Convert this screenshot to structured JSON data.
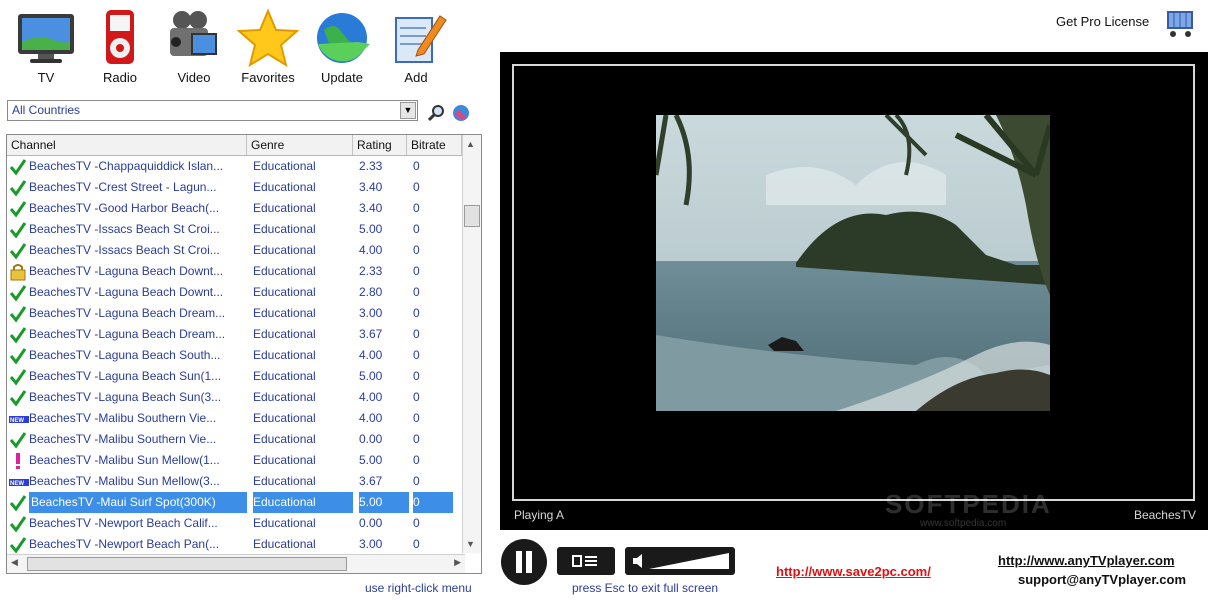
{
  "toolbar": {
    "items": [
      {
        "label": "TV",
        "icon": "tv-icon"
      },
      {
        "label": "Radio",
        "icon": "radio-icon"
      },
      {
        "label": "Video",
        "icon": "video-camera-icon"
      },
      {
        "label": "Favorites",
        "icon": "star-icon"
      },
      {
        "label": "Update",
        "icon": "globe-update-icon"
      },
      {
        "label": "Add",
        "icon": "add-notepad-icon"
      }
    ]
  },
  "pro_license": {
    "label": "Get Pro License",
    "icon": "shopping-cart-icon"
  },
  "country_filter": {
    "value": "All Countries",
    "icons": [
      "search-icon",
      "globe-filter-icon"
    ]
  },
  "channel_list": {
    "columns": [
      "Channel",
      "Genre",
      "Rating",
      "Bitrate"
    ],
    "rows": [
      {
        "status": "check",
        "channel": "BeachesTV -Chappaquiddick Islan...",
        "genre": "Educational",
        "rating": "2.33",
        "bitrate": "0"
      },
      {
        "status": "check",
        "channel": "BeachesTV -Crest Street - Lagun...",
        "genre": "Educational",
        "rating": "3.40",
        "bitrate": "0"
      },
      {
        "status": "check",
        "channel": "BeachesTV -Good Harbor Beach(...",
        "genre": "Educational",
        "rating": "3.40",
        "bitrate": "0"
      },
      {
        "status": "check",
        "channel": "BeachesTV -Issacs Beach St Croi...",
        "genre": "Educational",
        "rating": "5.00",
        "bitrate": "0"
      },
      {
        "status": "check",
        "channel": "BeachesTV -Issacs Beach St Croi...",
        "genre": "Educational",
        "rating": "4.00",
        "bitrate": "0"
      },
      {
        "status": "lock",
        "channel": "BeachesTV -Laguna Beach Downt...",
        "genre": "Educational",
        "rating": "2.33",
        "bitrate": "0"
      },
      {
        "status": "check",
        "channel": "BeachesTV -Laguna Beach Downt...",
        "genre": "Educational",
        "rating": "2.80",
        "bitrate": "0"
      },
      {
        "status": "check",
        "channel": "BeachesTV -Laguna Beach Dream...",
        "genre": "Educational",
        "rating": "3.00",
        "bitrate": "0"
      },
      {
        "status": "check",
        "channel": "BeachesTV -Laguna Beach Dream...",
        "genre": "Educational",
        "rating": "3.67",
        "bitrate": "0"
      },
      {
        "status": "check",
        "channel": "BeachesTV -Laguna Beach South...",
        "genre": "Educational",
        "rating": "4.00",
        "bitrate": "0"
      },
      {
        "status": "check",
        "channel": "BeachesTV -Laguna Beach Sun(1...",
        "genre": "Educational",
        "rating": "5.00",
        "bitrate": "0"
      },
      {
        "status": "check",
        "channel": "BeachesTV -Laguna Beach Sun(3...",
        "genre": "Educational",
        "rating": "4.00",
        "bitrate": "0"
      },
      {
        "status": "new",
        "channel": "BeachesTV -Malibu Southern Vie...",
        "genre": "Educational",
        "rating": "4.00",
        "bitrate": "0"
      },
      {
        "status": "check",
        "channel": "BeachesTV -Malibu Southern Vie...",
        "genre": "Educational",
        "rating": "0.00",
        "bitrate": "0"
      },
      {
        "status": "warn",
        "channel": "BeachesTV -Malibu Sun Mellow(1...",
        "genre": "Educational",
        "rating": "5.00",
        "bitrate": "0"
      },
      {
        "status": "new",
        "channel": "BeachesTV -Malibu Sun Mellow(3...",
        "genre": "Educational",
        "rating": "3.67",
        "bitrate": "0"
      },
      {
        "status": "check",
        "channel": "BeachesTV -Maui Surf Spot(300K)",
        "genre": "Educational",
        "rating": "5.00",
        "bitrate": "0",
        "selected": true
      },
      {
        "status": "check",
        "channel": "BeachesTV -Newport Beach Calif...",
        "genre": "Educational",
        "rating": "0.00",
        "bitrate": "0"
      },
      {
        "status": "check",
        "channel": "BeachesTV -Newport Beach Pan(...",
        "genre": "Educational",
        "rating": "3.00",
        "bitrate": "0"
      }
    ],
    "hint": "use right-click menu"
  },
  "player": {
    "status_left": "Playing A",
    "status_right": "BeachesTV",
    "watermark": "SOFTPEDIA",
    "watermark_sub": "www.softpedia.com"
  },
  "controls": {
    "hint": "press Esc to exit full screen",
    "icons": [
      "pause-icon",
      "playlist-toggle-icon",
      "volume-icon"
    ]
  },
  "links": {
    "save2pc": "http://www.save2pc.com/",
    "site": "http://www.anyTVplayer.com",
    "support": "support@anyTVplayer.com"
  },
  "colors": {
    "link_red": "#e01010",
    "list_text": "#2a3d9a",
    "selection": "#3d8ee6"
  }
}
